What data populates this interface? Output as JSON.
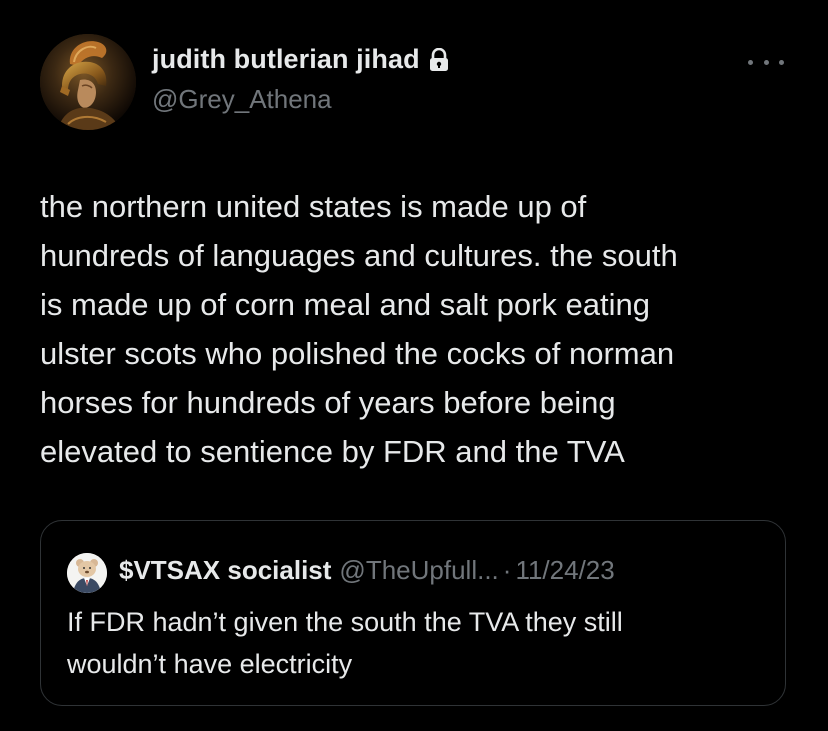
{
  "tweet": {
    "author_name": "judith butlerian jihad",
    "handle": "@Grey_Athena",
    "protected_icon": "lock-icon",
    "more_icon": "more-options-icon",
    "text": "the northern united states is made up of\nhundreds of languages and cultures. the south\nis made up of corn meal and salt pork eating\nulster scots who polished the cocks of norman\nhorses for hundreds of years before being\nelevated to sentience by FDR and the TVA"
  },
  "quote": {
    "author_name": "$VTSAX socialist",
    "handle": "@TheUpfull...",
    "separator": "·",
    "date": "11/24/23",
    "text": "If FDR hadn’t given the south the TVA they still\nwouldn’t have electricity"
  },
  "colors": {
    "background": "#000000",
    "primary_text": "#e7e9ea",
    "secondary_text": "#71767b",
    "border": "#2f3336"
  }
}
